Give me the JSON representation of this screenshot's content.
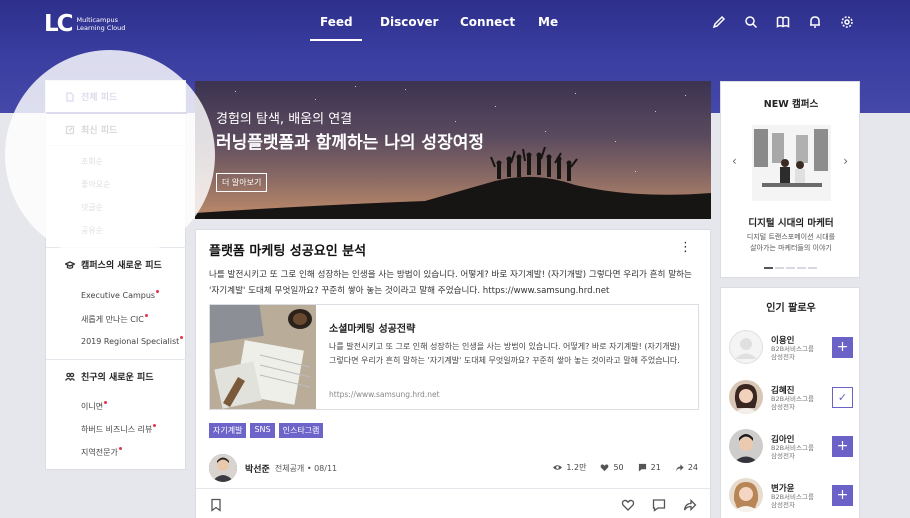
{
  "header": {
    "logo_mark": "LC",
    "logo_line1": "Multicampus",
    "logo_line2": "Learning Cloud",
    "nav": [
      "Feed",
      "Discover",
      "Connect",
      "Me"
    ],
    "icons": [
      "pencil-icon",
      "search-icon",
      "book-icon",
      "bell-icon",
      "gear-icon"
    ]
  },
  "sidebar": {
    "all_feed": "전체 피드",
    "latest_feed": "최신 피드",
    "sort": [
      "조회순",
      "좋아요순",
      "댓글순",
      "공유순"
    ],
    "campus_feed": "캠퍼스의 새로운 피드",
    "campus_items": [
      "Executive Campus",
      "새롭게 만나는 CIC",
      "2019 Regional Specialist"
    ],
    "friend_feed": "친구의 새로운 피드",
    "friend_items": [
      "이니면",
      "하버드 비즈니스 리뷰",
      "지역전문가"
    ]
  },
  "banner": {
    "line1": "경험의 탐색, 배움의 연결",
    "line2": "러닝플랫폼과 함께하는 나의 성장여정",
    "button": "더 알아보기"
  },
  "post": {
    "title": "플랫폼 마케팅 성공요인 분석",
    "body": "나를 발전시키고 또 그로 인해 성장하는 인생을 사는 방법이 있습니다. 어떻게? 바로 자기계발! (자기개발) 그렇다면 우리가 흔히 말하는 '자기계발' 도대체 무엇일까요? 꾸준히 쌓아 놓는 것이라고 말해 주었습니다. https://www.samsung.hrd.net",
    "link_title": "소셜마케팅 성공전략",
    "link_body": "나를 발전시키고 또 그로 인해 성장하는 인생을 사는 방법이 있습니다. 어떻게? 바로 자기계발! (자기개발) 그렇다면 우리가 흔히 말하는 '자기계발' 도대체 무엇일까요? 꾸준히 쌓아 놓는 것이라고 말해 주었습니다.",
    "link_url": "https://www.samsung.hrd.net",
    "tags": [
      "자기계발",
      "SNS",
      "인스타그램"
    ],
    "author": "박선준",
    "meta": "전체공개 • 08/11",
    "views": "1.2만",
    "likes": "50",
    "comments": "21",
    "shares": "24"
  },
  "new_campus": {
    "title": "NEW 캠퍼스",
    "item_title": "디지털 시대의 마케터",
    "item_desc1": "디지털 트랜스포메이션 시대를",
    "item_desc2": "살아가는 마케터들의 이야기"
  },
  "follow": {
    "title": "인기 팔로우",
    "people": [
      {
        "name": "이용인",
        "dept1": "B2B서비스그룹",
        "dept2": "삼성전자",
        "followed": false
      },
      {
        "name": "김혜진",
        "dept1": "B2B서비스그룹",
        "dept2": "삼성전자",
        "followed": true
      },
      {
        "name": "김아인",
        "dept1": "B2B서비스그룹",
        "dept2": "삼성전자",
        "followed": false
      },
      {
        "name": "변가윤",
        "dept1": "B2B서비스그룹",
        "dept2": "삼성전자",
        "followed": false
      }
    ],
    "follow_symbol": "+",
    "followed_symbol": "✓"
  },
  "colors": {
    "header": "#3a3ea0",
    "accent": "#6b62c8",
    "notification_dot": "#e8334a"
  }
}
